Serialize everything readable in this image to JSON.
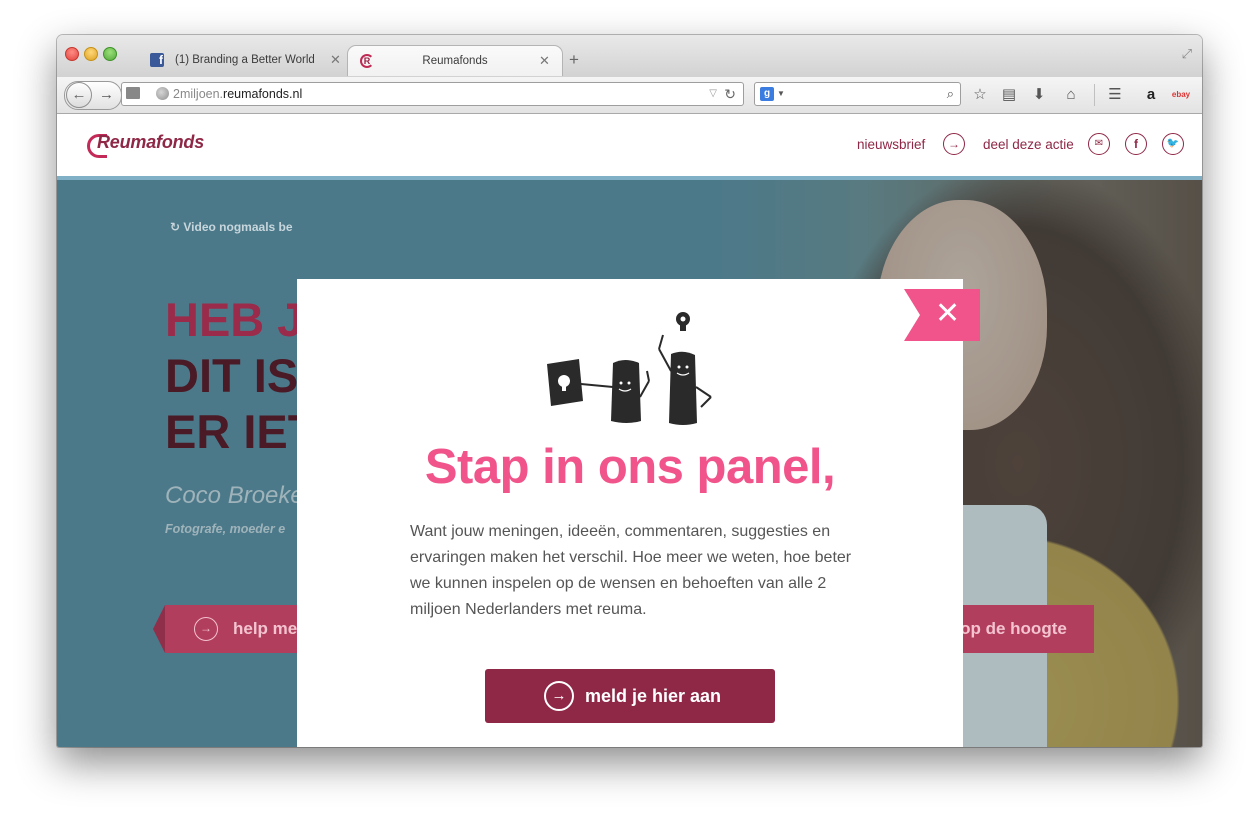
{
  "browser": {
    "tabs": [
      {
        "title": "(1) Branding a Better World",
        "favicon": "facebook-icon"
      },
      {
        "title": "Reumafonds",
        "favicon": "reumafonds-icon",
        "active": true
      }
    ],
    "address": {
      "prefix": "2miljoen.",
      "domain": "reumafonds.nl"
    },
    "search_engine_letter": "g",
    "toolbar_icons": [
      "star-icon",
      "clipboard-icon",
      "download-icon",
      "home-icon",
      "menu-icon",
      "amazon-icon",
      "ebay-icon"
    ],
    "amazon_label": "a",
    "ebay_label": "ebay"
  },
  "site": {
    "logo": "Reumafonds",
    "nav": {
      "newsletter": "nieuwsbrief",
      "share": "deel deze actie"
    },
    "share_icons": [
      "mail-icon",
      "facebook-icon",
      "twitter-icon"
    ]
  },
  "hero": {
    "replay": "Video nogmaals be",
    "headline": [
      "HEB JI",
      "DIT IS",
      "ER IET"
    ],
    "name": "Coco Broeke",
    "role": "Fotografe, moeder e",
    "left_button": "help me",
    "right_button": "jf op de hoogte"
  },
  "modal": {
    "title": "Stap in ons panel,",
    "body": "Want jouw meningen, ideeën, commentaren, suggesties en ervaringen maken het verschil. Hoe meer we weten, hoe beter we kunnen inspelen op de wensen en behoeften van alle 2 miljoen Nederlanders met reuma.",
    "cta": "meld je hier aan"
  },
  "colors": {
    "brand": "#8f2746",
    "accent_pink": "#f0548a",
    "hero_blue": "#5b8a9a"
  }
}
